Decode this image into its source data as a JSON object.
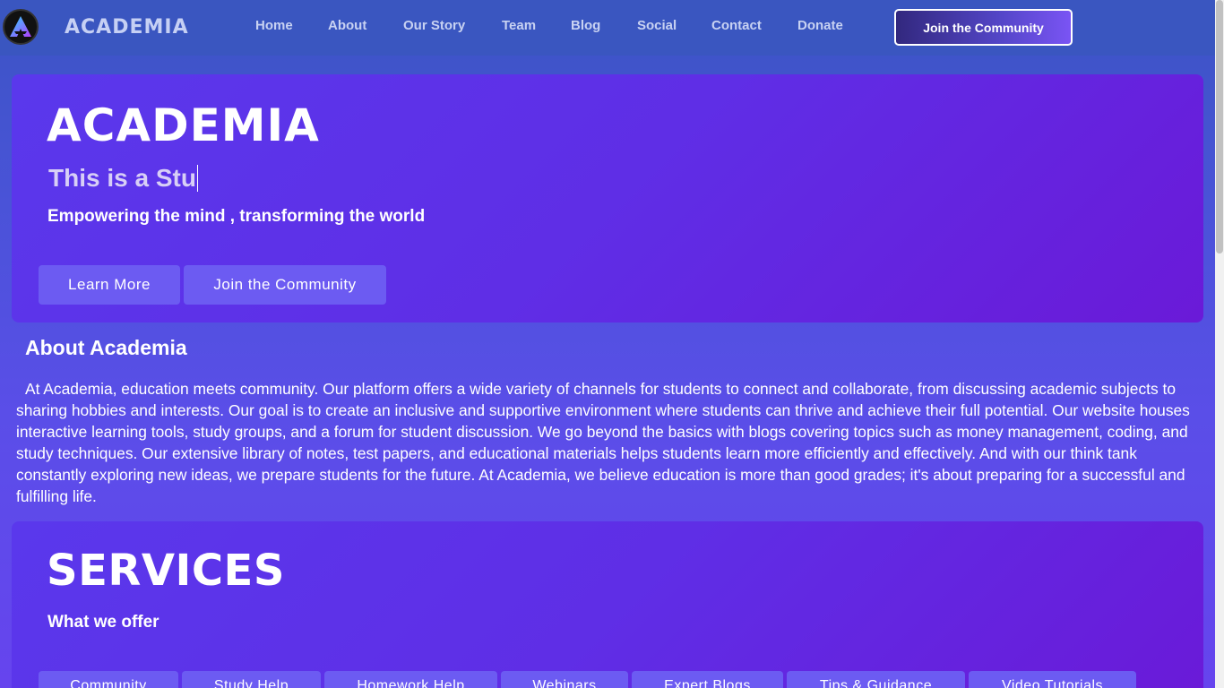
{
  "nav": {
    "brand": "ACADEMIA",
    "links": [
      "Home",
      "About",
      "Our Story",
      "Team",
      "Blog",
      "Social",
      "Contact",
      "Donate"
    ],
    "cta": "Join the Community"
  },
  "hero": {
    "logo": "ACADEMIA",
    "typing": "This is a Stu",
    "tagline": "Empowering the mind , transforming the world",
    "buttons": [
      "Learn More",
      "Join the Community"
    ]
  },
  "about": {
    "title": "About Academia",
    "text": "At Academia, education meets community. Our platform offers a wide variety of channels for students to connect and collaborate, from discussing academic subjects to sharing hobbies and interests. Our goal is to create an inclusive and supportive environment where students can thrive and achieve their full potential. Our website houses interactive learning tools, study groups, and a forum for student discussion. We go beyond the basics with blogs covering topics such as money management, coding, and study techniques. Our extensive library of notes, test papers, and educational materials helps students learn more efficiently and effectively. And with our think tank constantly exploring new ideas, we prepare students for the future. At Academia, we believe education is more than good grades; it's about preparing for a successful and fulfilling life."
  },
  "services": {
    "title": "SERVICES",
    "subtitle": "What we offer",
    "items": [
      "Community",
      "Study Help",
      "Homework Help",
      "Webinars",
      "Expert Blogs",
      "Tips & Guidance",
      "Video Tutorials"
    ]
  },
  "colors": {
    "accent": "#6c5bf2",
    "hero_bg": "#5f2ee6",
    "navbar_bg": "#3a56c0"
  }
}
